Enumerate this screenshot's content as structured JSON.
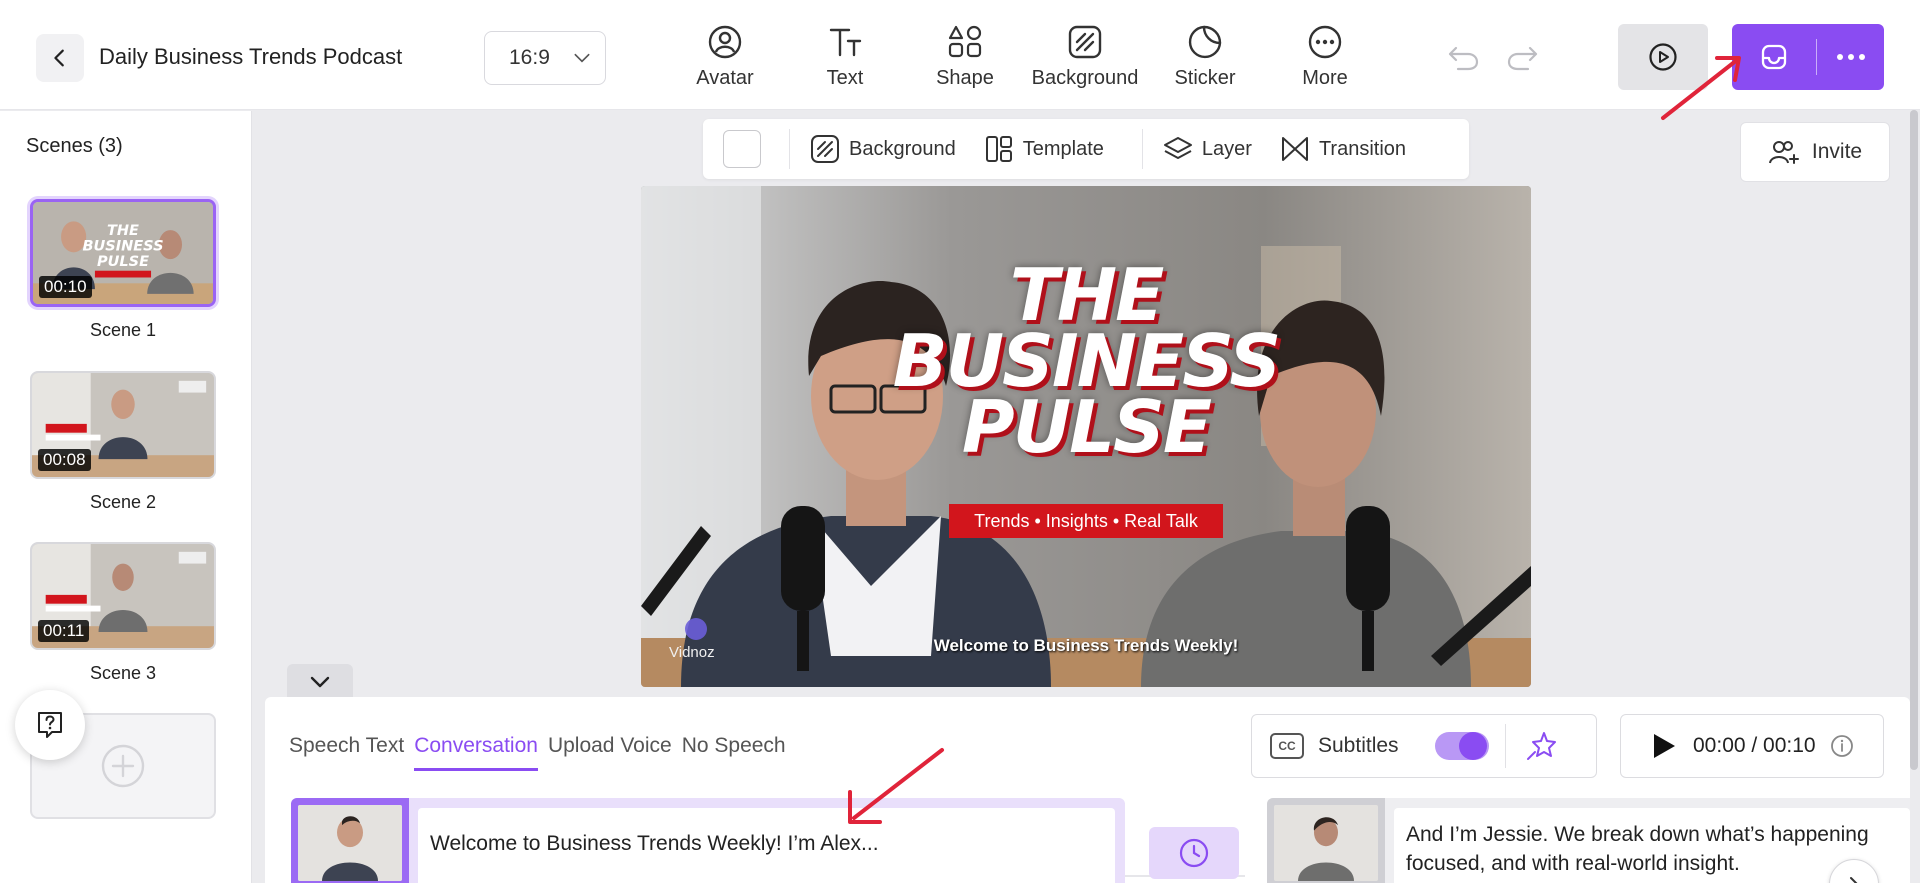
{
  "header": {
    "project_title": "Daily Business Trends Podcast",
    "aspect_ratio": "16:9",
    "tools": [
      {
        "label": "Avatar",
        "icon": "avatar-icon"
      },
      {
        "label": "Text",
        "icon": "text-icon"
      },
      {
        "label": "Shape",
        "icon": "shape-icon"
      },
      {
        "label": "Background",
        "icon": "background-icon"
      },
      {
        "label": "Sticker",
        "icon": "sticker-icon"
      },
      {
        "label": "More",
        "icon": "more-icon"
      }
    ]
  },
  "sidebar": {
    "title": "Scenes (3)",
    "scenes": [
      {
        "name": "Scene 1",
        "duration": "00:10",
        "active": true
      },
      {
        "name": "Scene 2",
        "duration": "00:08",
        "active": false
      },
      {
        "name": "Scene 3",
        "duration": "00:11",
        "active": false
      }
    ]
  },
  "canvas_toolbar": {
    "background_label": "Background",
    "template_label": "Template",
    "layer_label": "Layer",
    "transition_label": "Transition"
  },
  "invite_label": "Invite",
  "video": {
    "headline": [
      "THE",
      "BUSINESS",
      "PULSE"
    ],
    "tagline": "Trends • Insights • Real Talk",
    "caption": "Welcome to Business Trends Weekly!",
    "watermark": "Vidnoz"
  },
  "speech_panel": {
    "tabs": [
      "Speech Text",
      "Conversation",
      "Upload Voice",
      "No Speech"
    ],
    "active_tab": "Conversation",
    "subtitles_label": "Subtitles",
    "subtitles_on": true,
    "time": "00:00 / 00:10",
    "dialog_1": "Welcome to Business Trends Weekly! I’m Alex...",
    "dialog_2_line1": "And I’m Jessie. We break down what’s happening",
    "dialog_2_line2": "focused, and with real-world insight."
  },
  "colors": {
    "accent": "#8a4cf2",
    "tagline_red": "#d2151c",
    "annotation_red": "#e0243a"
  }
}
